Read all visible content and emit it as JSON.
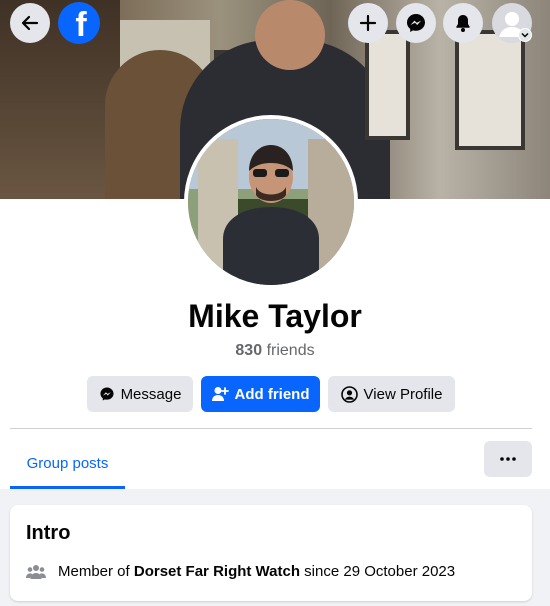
{
  "header": {
    "back_icon": "arrow-left-icon",
    "logo_icon": "facebook-logo",
    "logo_letter": "f",
    "create_icon": "plus-icon",
    "messenger_icon": "messenger-icon",
    "notifications_icon": "bell-icon",
    "account_icon": "avatar-icon",
    "account_chevron_icon": "chevron-down-icon"
  },
  "profile": {
    "name": "Mike Taylor",
    "friends_count": "830",
    "friends_label": "friends"
  },
  "actions": {
    "message_label": "Message",
    "add_friend_label": "Add friend",
    "view_profile_label": "View Profile"
  },
  "tabs": [
    {
      "label": "Group posts",
      "active": true
    }
  ],
  "intro": {
    "title": "Intro",
    "member_of_prefix": "Member of",
    "group_name": "Dorset Far Right Watch",
    "since_prefix": "since",
    "since_date": "29 October 2023"
  },
  "colors": {
    "accent": "#0866ff",
    "button_gray": "#e4e6eb",
    "page_bg": "#f0f2f5",
    "secondary_text": "#65676b"
  }
}
